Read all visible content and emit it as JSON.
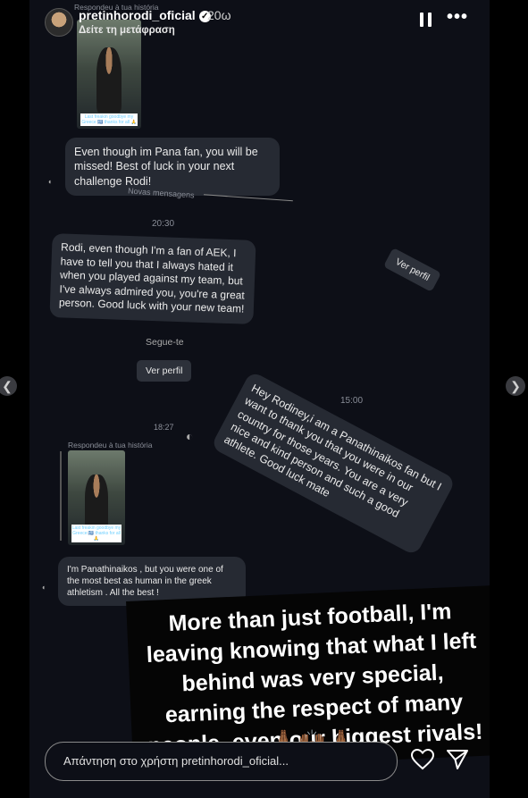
{
  "header": {
    "username": "pretinhorodi_oficial",
    "time": "20ω",
    "translate": "Δείτε τη μετάφραση"
  },
  "chat": {
    "replied_top": "Respondeu à tua história",
    "thumb_caption": "Last freakin goodbye my Greece 🇬🇷 thanks for all 🙏",
    "msg1": "Even though im Pana fan, you will be missed! Best of luck in your next challenge Rodi!",
    "new_messages": "Novas mensagens",
    "time1": "20:30",
    "msg2": "Rodi, even though I'm a fan of AEK, I have to tell you that I always hated it when you played against my team, but I've always admired you, you're a great person. Good luck with your new team!",
    "ver_perfil_tilted": "Ver perfil",
    "follows_you": "Segue-te",
    "ver_perfil": "Ver perfil",
    "time2": "15:00",
    "msg3": "Hey Rodiney,i am a Panathinaikos fan but I want to thank you that you were in our country for those years. You are a very nice and kind person and such a good athlete. Good luck mate",
    "time3": "18:27",
    "replied_bottom": "Respondeu à tua história",
    "msg4": "I'm Panathinaikos , but you were one of the most best as human in the greek athletism . All the best !"
  },
  "story_caption": "More than just football, I'm leaving knowing that what I left behind was very special, earning the respect of many people, even our biggest rivals!",
  "emojis": "🙏🏾🙌🏾🙏🏾",
  "reply": {
    "placeholder": "Απάντηση στο χρήστη pretinhorodi_oficial..."
  },
  "icons": [
    "verified-icon",
    "pause-icon",
    "more-icon",
    "heart-icon",
    "send-icon",
    "chevron-left-icon",
    "chevron-right-icon"
  ]
}
